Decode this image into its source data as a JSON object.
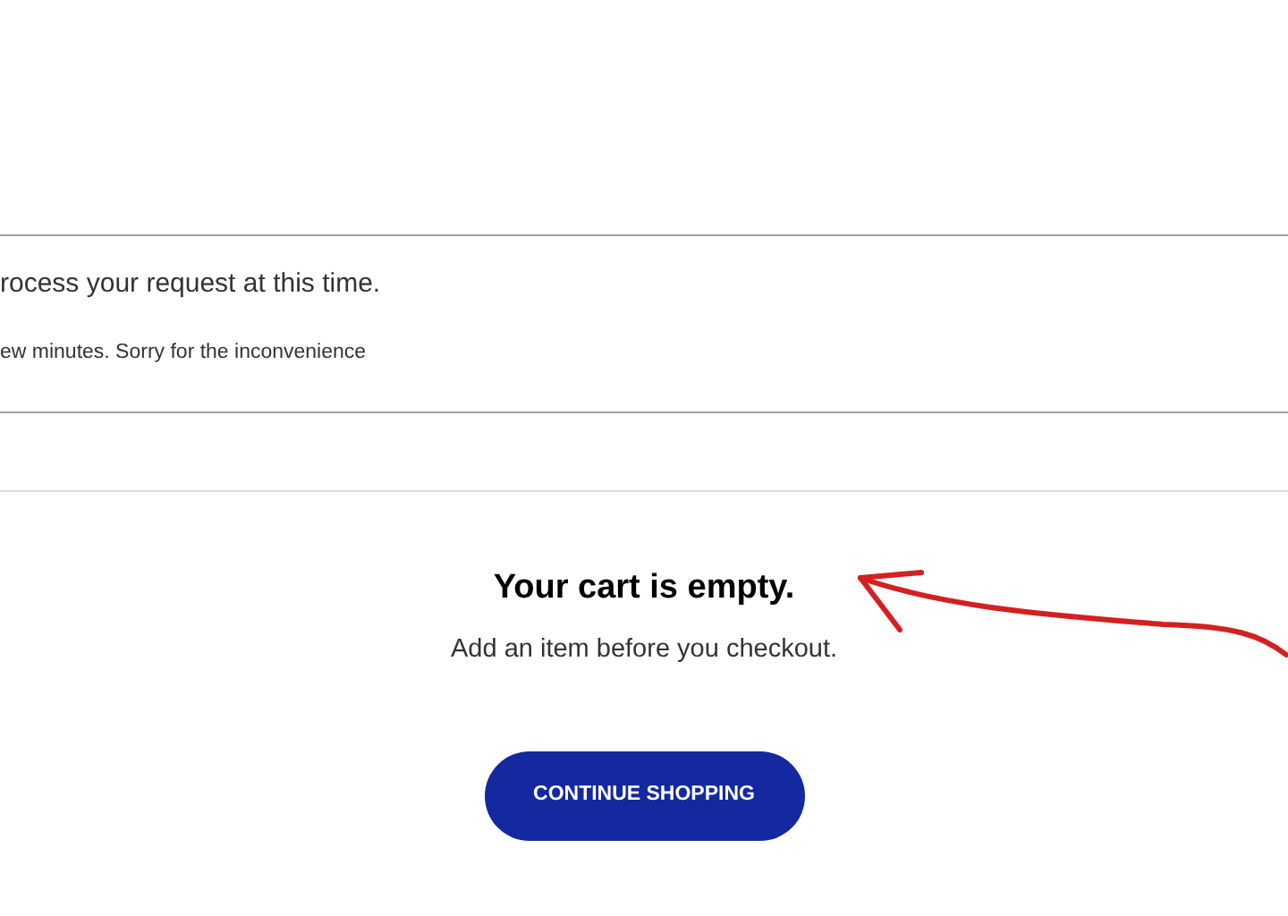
{
  "error_notice": {
    "title": "rocess your request at this time.",
    "message": "ew minutes. Sorry for the inconvenience"
  },
  "empty_cart": {
    "heading": "Your cart is empty.",
    "subtext": "Add an item before you checkout.",
    "button": "CONTINUE SHOPPING"
  }
}
